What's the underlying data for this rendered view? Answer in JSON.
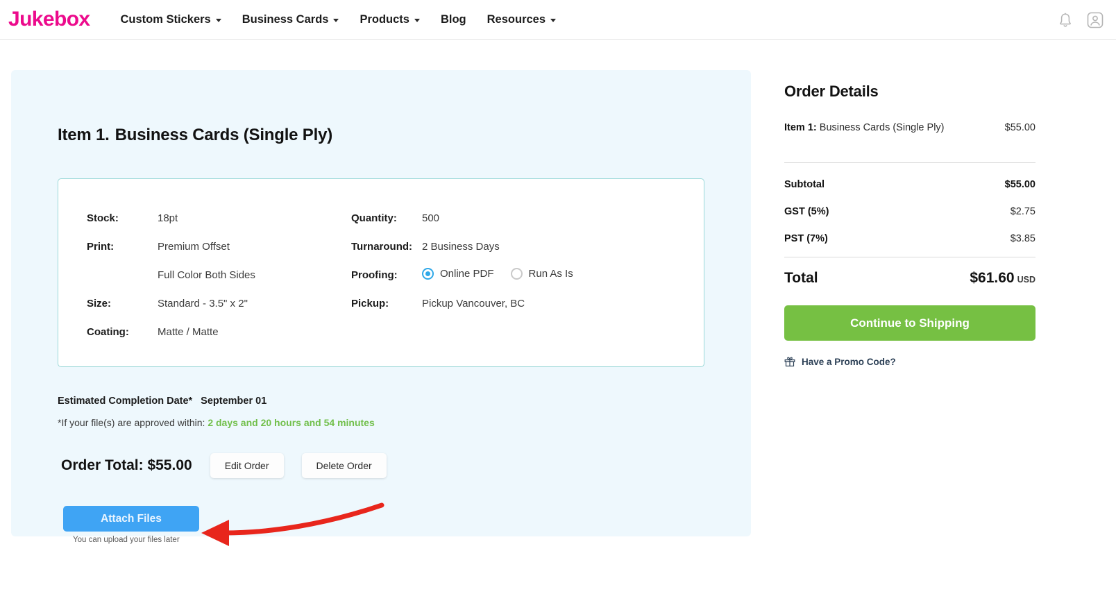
{
  "header": {
    "logo": "Jukebox",
    "nav": [
      {
        "label": "Custom Stickers",
        "has_caret": true
      },
      {
        "label": "Business Cards",
        "has_caret": true
      },
      {
        "label": "Products",
        "has_caret": true
      },
      {
        "label": "Blog",
        "has_caret": false
      },
      {
        "label": "Resources",
        "has_caret": true
      }
    ],
    "icons": [
      {
        "name": "notification-bell-icon"
      },
      {
        "name": "account-avatar-icon"
      }
    ]
  },
  "item": {
    "title_number": "Item 1.",
    "title_name": "Business Cards (Single Ply)",
    "specs_left": [
      {
        "label": "Stock:",
        "value": "18pt"
      },
      {
        "label": "Print:",
        "value": "Premium Offset",
        "sub": "Full Color Both Sides"
      },
      {
        "label": "Size:",
        "value": "Standard - 3.5\" x 2\""
      },
      {
        "label": "Coating:",
        "value": "Matte / Matte"
      }
    ],
    "specs_right": [
      {
        "label": "Quantity:",
        "value": "500"
      },
      {
        "label": "Turnaround:",
        "value": "2 Business Days"
      }
    ],
    "proofing": {
      "label": "Proofing:",
      "options": [
        {
          "label": "Online PDF",
          "selected": true
        },
        {
          "label": "Run As Is",
          "selected": false
        }
      ]
    },
    "pickup": {
      "label": "Pickup:",
      "value": "Pickup Vancouver, BC"
    },
    "estimated": {
      "label": "Estimated Completion Date*",
      "date": "September  01"
    },
    "approval": {
      "prefix": "*If your file(s) are approved within: ",
      "window": "2 days and 20 hours and 54 minutes"
    },
    "order_total_label": "Order Total: $55.00",
    "edit_label": "Edit Order",
    "delete_label": "Delete Order",
    "attach_label": "Attach Files",
    "attach_note": "You can upload your files later"
  },
  "order_details": {
    "title": "Order Details",
    "line_items": [
      {
        "prefix": "Item 1:",
        "name": "Business Cards (Single Ply)",
        "price": "$55.00"
      }
    ],
    "totals": [
      {
        "label": "Subtotal",
        "value": "$55.00",
        "strong": true
      },
      {
        "label": "GST (5%)",
        "value": "$2.75",
        "strong": false
      },
      {
        "label": "PST (7%)",
        "value": "$3.85",
        "strong": false
      }
    ],
    "grand": {
      "label": "Total",
      "value": "$61.60",
      "currency": "USD"
    },
    "continue_label": "Continue to Shipping",
    "promo_label": "Have a Promo Code?"
  },
  "colors": {
    "brand_pink": "#ec0a8c",
    "card_bg": "#eef8fd",
    "spec_border": "#9ad8d8",
    "blue_button": "#3fa4f4",
    "green_button": "#76c043",
    "green_text": "#71bf4a",
    "radio_accent": "#2fa8e8",
    "annotation_arrow": "#e8261c"
  }
}
